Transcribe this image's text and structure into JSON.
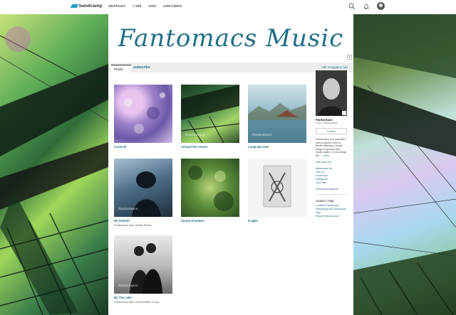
{
  "topbar": {
    "logo_text": "bandcamp",
    "nav": [
      "dashboard",
      "+ add",
      "stats",
      "subscription"
    ]
  },
  "header": {
    "band_title": "Fantomacs Music",
    "expand_label": "▴"
  },
  "tabs": {
    "music": "music",
    "subscribe": "subscribe",
    "edit_nav": "edit navigation bar"
  },
  "albums": [
    {
      "title": "Loose It!",
      "subtitle": ""
    },
    {
      "title": "Around the Corner",
      "subtitle": "",
      "cover_text": "Fantomacs"
    },
    {
      "title": "LongLake Dub",
      "subtitle": "",
      "cover_text": "Fantomacs"
    },
    {
      "title": "Re-Visited!",
      "subtitle": "Fantomacs feat. Sarah Peters",
      "cover_text": "Fantomacs"
    },
    {
      "title": "Sound of Nature",
      "subtitle": ""
    },
    {
      "title": "Fragile",
      "subtitle": ""
    },
    {
      "title": "By The Lake",
      "subtitle": "Fantomacs feat. Heidi Walter Group",
      "cover_text": "Fantomacs"
    }
  ],
  "sidebar": {
    "artist_name": "Fantomacs",
    "location": "Thun, Switzerland",
    "follow_label": "Follow",
    "bio": "Fantomacs is a musician and producer born in Berlin offering a broad range of genres and music styles. In his songs the ...",
    "bio_more": "more",
    "edit_artist": "edit artist bio",
    "links": [
      "fantomacs.de",
      "vuul.ch",
      "Facebook",
      "Instagram",
      "YouTube"
    ],
    "recommendations": "Recommendations",
    "contact_heading": "contact / help",
    "contact_links": [
      "Contact Fantomacs",
      "Streaming and Download help",
      "Report this account"
    ]
  },
  "colors": {
    "accent": "#1f6f86",
    "tabbar": "#eeeeee"
  }
}
